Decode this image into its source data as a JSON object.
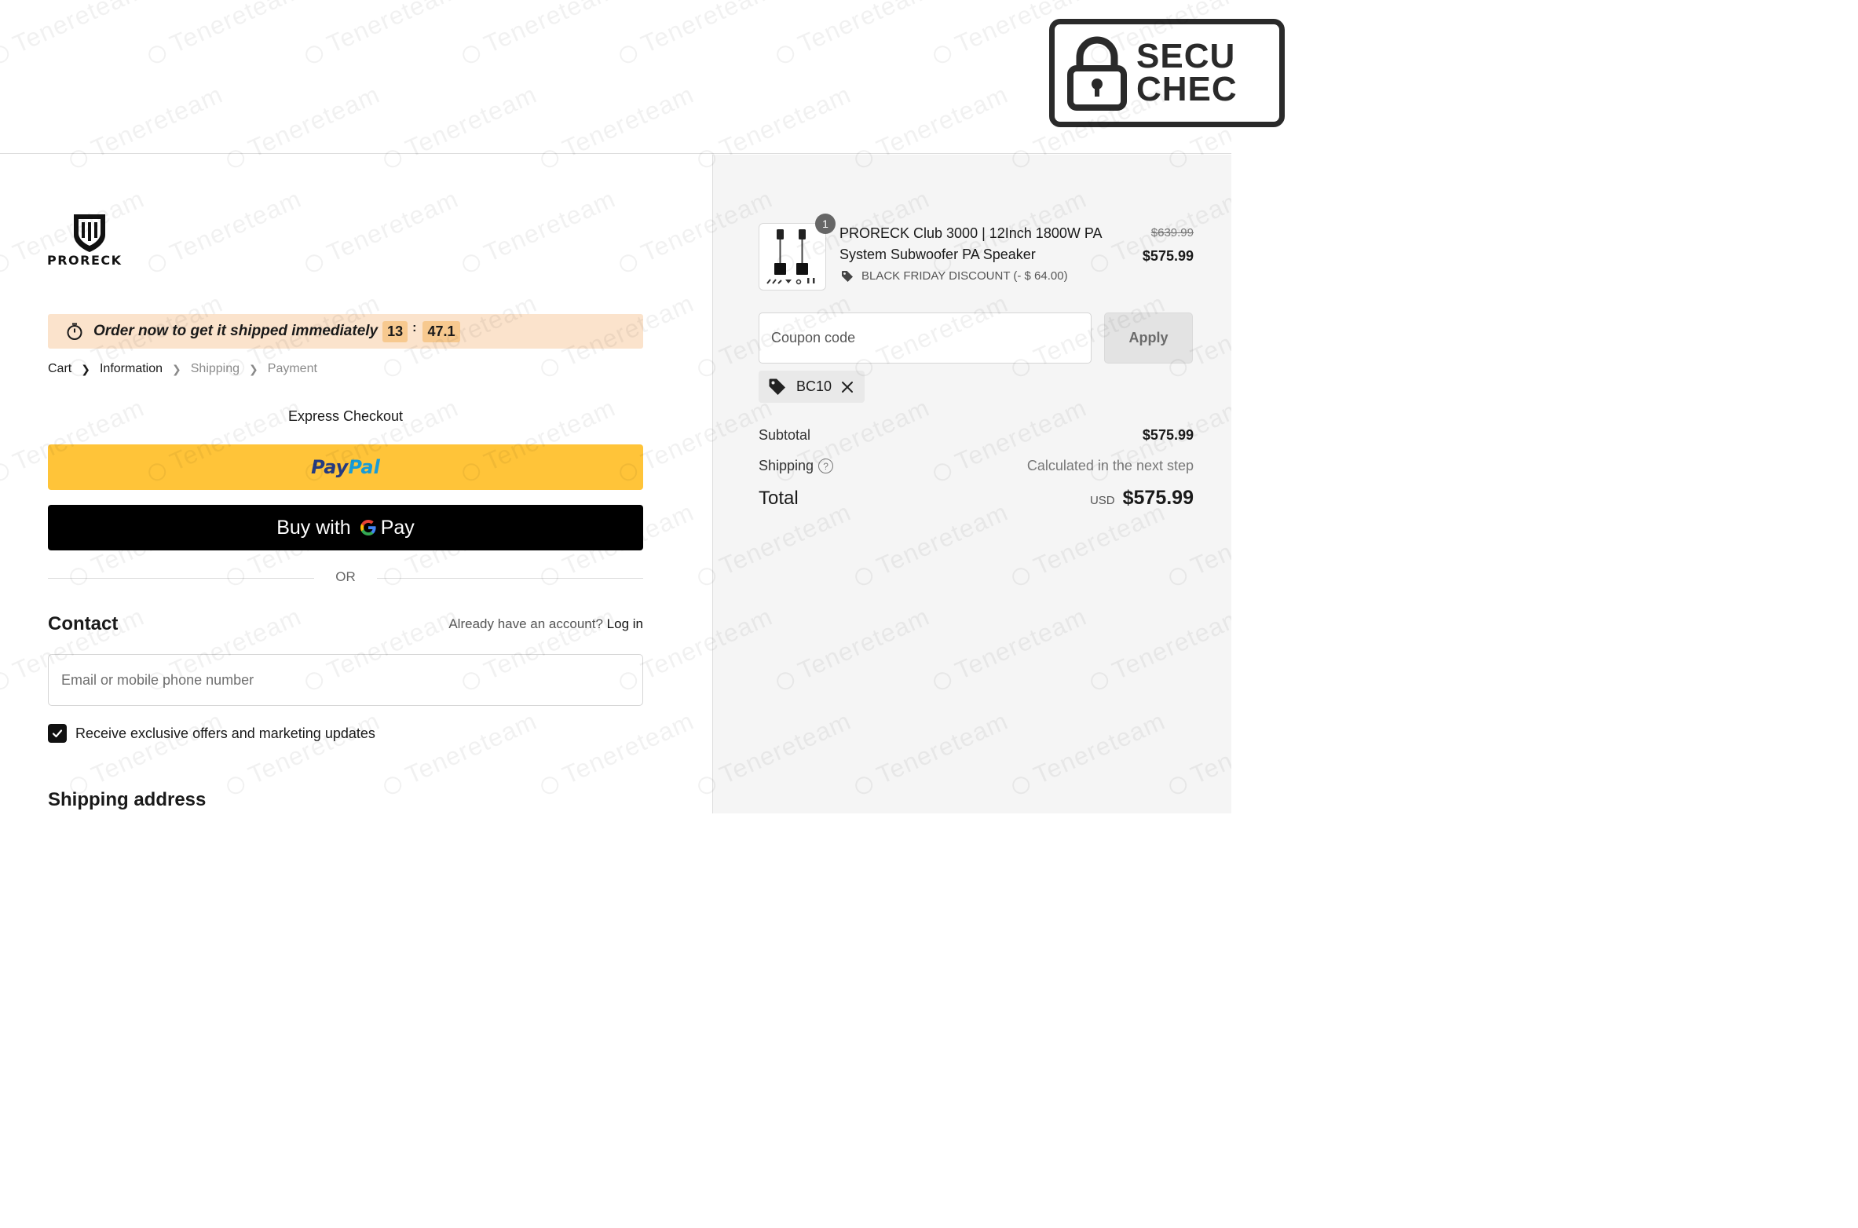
{
  "header": {
    "badge_line1": "SECU",
    "badge_line2": "CHEC"
  },
  "brand": {
    "name": "PRORECK"
  },
  "promo": {
    "text": "Order now to get it shipped immediately",
    "minutes": "13",
    "seconds": "47.1"
  },
  "breadcrumb": {
    "items": [
      "Cart",
      "Information",
      "Shipping",
      "Payment"
    ]
  },
  "express": {
    "title": "Express Checkout",
    "paypal_part1": "Pay",
    "paypal_part2": "Pal",
    "gpay_prefix": "Buy with",
    "gpay_suffix": "Pay",
    "or_text": "OR"
  },
  "contact": {
    "title": "Contact",
    "account_prompt": "Already have an account?",
    "login_link": "Log in",
    "email_placeholder": "Email or mobile phone number",
    "offers_label": "Receive exclusive offers and marketing updates",
    "offers_checked": true
  },
  "shipping_address": {
    "title": "Shipping address"
  },
  "order": {
    "quantity": "1",
    "product_name": "PRORECK Club 3000 | 12Inch 1800W PA System Subwoofer PA Speaker",
    "original_price": "$639.99",
    "price": "$575.99",
    "discount_label": "BLACK FRIDAY DISCOUNT (- $ 64.00)",
    "coupon_placeholder": "Coupon code",
    "apply_label": "Apply",
    "applied_code": "BC10",
    "subtotal_label": "Subtotal",
    "subtotal_value": "$575.99",
    "shipping_label": "Shipping",
    "shipping_value": "Calculated in the next step",
    "total_label": "Total",
    "total_currency": "USD",
    "total_value": "$575.99"
  },
  "watermark": {
    "text": "Tenereteam"
  },
  "colors": {
    "promo_bg": "#fbe3cc",
    "countdown_bg": "#f7c98f",
    "paypal_yellow": "#ffc439",
    "paypal_dark_blue": "#253b80",
    "paypal_light_blue": "#179bd7",
    "gpay_black": "#000000",
    "summary_bg": "#f5f5f5"
  },
  "icons": {
    "lock": "lock-icon",
    "timer": "stopwatch-icon",
    "chevron": "chevron-right-icon",
    "tag": "tag-icon",
    "close": "close-icon",
    "help": "question-circle-icon",
    "check": "checkmark-icon"
  }
}
